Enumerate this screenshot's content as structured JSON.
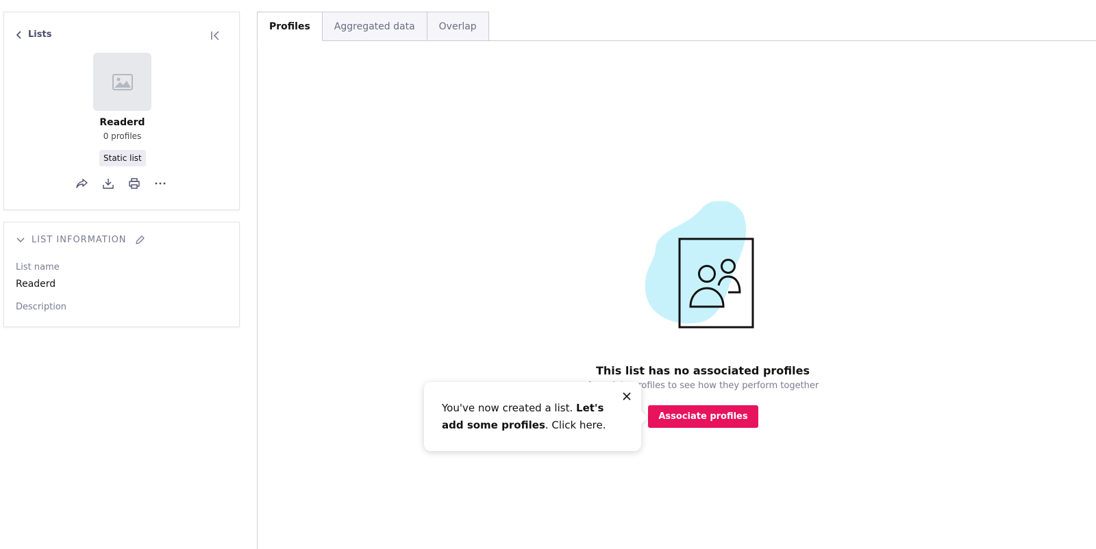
{
  "sidebar": {
    "back_label": "Lists",
    "list_title": "Readerd",
    "profile_count": "0 profiles",
    "badge": "Static list",
    "info": {
      "header": "LIST INFORMATION",
      "name_label": "List name",
      "name_value": "Readerd",
      "description_label": "Description"
    }
  },
  "tabs": [
    {
      "label": "Profiles",
      "active": true
    },
    {
      "label": "Aggregated data",
      "active": false
    },
    {
      "label": "Overlap",
      "active": false
    }
  ],
  "empty_state": {
    "title": "This list has no associated profiles",
    "subtitle": "Associate profiles to see how they perform together",
    "button_label": "Associate profiles"
  },
  "tooltip": {
    "text_start": "You've now created a list. ",
    "text_bold": "Let's add some profiles",
    "text_end": ". Click here."
  },
  "colors": {
    "accent": "#e8135d",
    "blob": "#c8f2fb"
  },
  "icons": [
    "chevron-left-icon",
    "collapse-left-icon",
    "image-placeholder-icon",
    "share-icon",
    "download-icon",
    "print-icon",
    "more-icon",
    "chevron-down-icon",
    "pencil-icon",
    "close-icon"
  ]
}
